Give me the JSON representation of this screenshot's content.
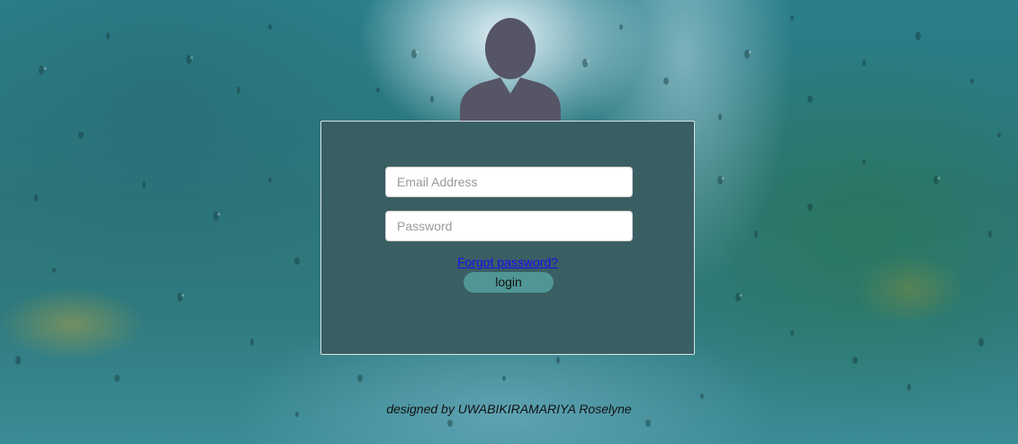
{
  "login_form": {
    "email_placeholder": "Email Address",
    "email_value": "",
    "password_placeholder": "Password",
    "password_value": "",
    "forgot_password_label": "Forgot password?",
    "login_button_label": "login"
  },
  "footer": {
    "credit": "designed by UWABIKIRAMARIYA Roselyne"
  },
  "icons": {
    "avatar": "user-silhouette-icon"
  },
  "colors": {
    "card_background": "#3a5f63",
    "login_button": "#4f9695",
    "avatar_fill": "#555566",
    "link": "#1a0dee"
  }
}
